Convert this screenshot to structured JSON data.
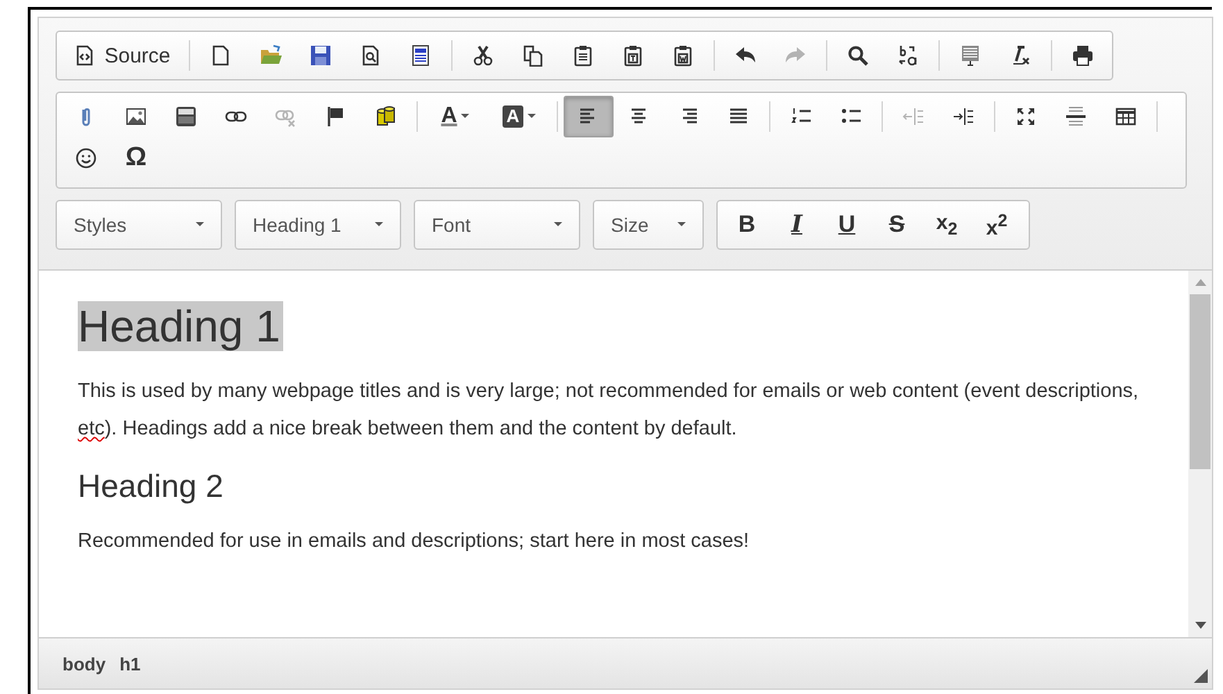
{
  "toolbar_rows": [
    {
      "groups": [
        {
          "buttons": [
            {
              "kind": "source",
              "label": "Source",
              "disabled": false,
              "on": false
            }
          ]
        },
        {
          "buttons": [
            {
              "kind": "newpage",
              "disabled": false,
              "on": false
            },
            {
              "kind": "open",
              "disabled": false,
              "on": false
            },
            {
              "kind": "save",
              "disabled": false,
              "on": false
            },
            {
              "kind": "preview",
              "disabled": false,
              "on": false
            },
            {
              "kind": "templates",
              "disabled": false,
              "on": false
            }
          ]
        },
        {
          "buttons": [
            {
              "kind": "cut",
              "disabled": false,
              "on": false
            },
            {
              "kind": "copy",
              "disabled": false,
              "on": false
            },
            {
              "kind": "paste",
              "disabled": false,
              "on": false
            },
            {
              "kind": "pastetext",
              "disabled": false,
              "on": false
            },
            {
              "kind": "pasteword",
              "disabled": false,
              "on": false
            }
          ]
        },
        {
          "buttons": [
            {
              "kind": "undo",
              "disabled": false,
              "on": false
            },
            {
              "kind": "redo",
              "disabled": true,
              "on": false
            }
          ]
        },
        {
          "buttons": [
            {
              "kind": "find",
              "disabled": false,
              "on": false
            },
            {
              "kind": "replace",
              "disabled": false,
              "on": false
            }
          ]
        },
        {
          "buttons": [
            {
              "kind": "selectall",
              "disabled": false,
              "on": false
            },
            {
              "kind": "removeformat",
              "disabled": false,
              "on": false
            }
          ]
        },
        {
          "buttons": [
            {
              "kind": "print",
              "disabled": false,
              "on": false
            }
          ]
        }
      ]
    },
    {
      "groups": [
        {
          "buttons": [
            {
              "kind": "attach",
              "disabled": false,
              "on": false
            },
            {
              "kind": "image",
              "disabled": false,
              "on": false
            },
            {
              "kind": "video",
              "disabled": false,
              "on": false
            },
            {
              "kind": "link",
              "disabled": false,
              "on": false
            },
            {
              "kind": "unlink",
              "disabled": true,
              "on": false
            },
            {
              "kind": "anchor",
              "disabled": false,
              "on": false
            },
            {
              "kind": "object",
              "disabled": false,
              "on": false
            }
          ]
        },
        {
          "buttons": [
            {
              "kind": "textcolor",
              "label": "A",
              "disabled": false,
              "on": false
            },
            {
              "kind": "bgcolor",
              "label": "A",
              "disabled": false,
              "on": false
            }
          ]
        },
        {
          "buttons": [
            {
              "kind": "alignleft",
              "disabled": false,
              "on": true
            },
            {
              "kind": "aligncenter",
              "disabled": false,
              "on": false
            },
            {
              "kind": "alignright",
              "disabled": false,
              "on": false
            },
            {
              "kind": "justify",
              "disabled": false,
              "on": false
            }
          ]
        },
        {
          "buttons": [
            {
              "kind": "numbered",
              "disabled": false,
              "on": false
            },
            {
              "kind": "bulleted",
              "disabled": false,
              "on": false
            }
          ]
        },
        {
          "buttons": [
            {
              "kind": "outdent",
              "disabled": true,
              "on": false
            },
            {
              "kind": "indent",
              "disabled": false,
              "on": false
            }
          ]
        },
        {
          "buttons": [
            {
              "kind": "maximize",
              "disabled": false,
              "on": false
            },
            {
              "kind": "rule",
              "disabled": false,
              "on": false
            },
            {
              "kind": "table",
              "disabled": false,
              "on": false
            }
          ]
        },
        {
          "buttons": [
            {
              "kind": "smiley",
              "disabled": false,
              "on": false
            },
            {
              "kind": "char",
              "label": "Ω",
              "disabled": false,
              "on": false
            }
          ]
        }
      ]
    }
  ],
  "format_row": {
    "combos": [
      {
        "label": "Styles"
      },
      {
        "label": "Heading 1"
      },
      {
        "label": "Font"
      },
      {
        "label": "Size"
      }
    ],
    "buttons": [
      {
        "kind": "bold",
        "label": "B",
        "disabled": false,
        "on": false
      },
      {
        "kind": "italic",
        "label": "I",
        "disabled": false,
        "on": false
      },
      {
        "kind": "underline",
        "label": "U",
        "disabled": false,
        "on": false
      },
      {
        "kind": "strike",
        "label": "S",
        "disabled": false,
        "on": false
      },
      {
        "kind": "sub",
        "label": "x$_{2}$",
        "disabled": false,
        "on": false
      },
      {
        "kind": "sup",
        "label": "x$^{2}$",
        "disabled": false,
        "on": false
      }
    ]
  },
  "content": [
    {
      "kind": "h1",
      "text": "Heading 1",
      "selected": true
    },
    {
      "kind": "p",
      "parts": [
        {
          "text": "This is used by many webpage titles and is very large; not recommended for emails or web content (event descriptions, ",
          "misspelled": false
        },
        {
          "text": "etc",
          "misspelled": true
        },
        {
          "text": "). Headings add a nice break between them and the content by default.",
          "misspelled": false
        }
      ]
    },
    {
      "kind": "h2",
      "text": "Heading 2",
      "selected": false
    },
    {
      "kind": "p",
      "parts": [
        {
          "text": "Recommended for use in emails and descriptions; start here in most cases!",
          "misspelled": false
        }
      ]
    }
  ],
  "status_bar": {
    "path": [
      "body",
      "h1"
    ]
  }
}
